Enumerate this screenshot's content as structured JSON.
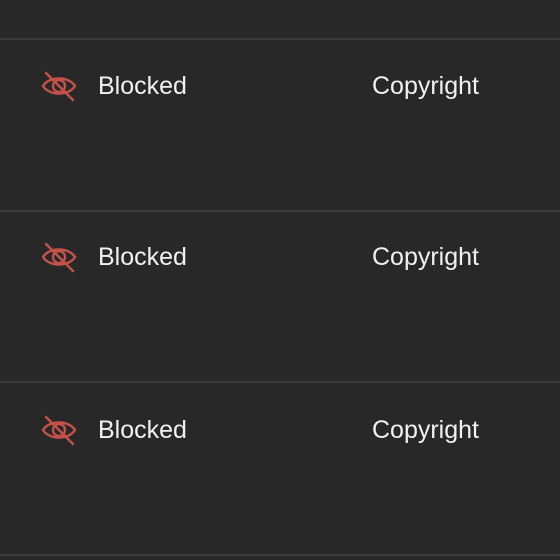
{
  "colors": {
    "background": "#282828",
    "divider": "#3a3a3a",
    "text": "#f1f1f1",
    "blocked_icon": "#c4524a"
  },
  "rows": [
    {
      "visibility": "Blocked",
      "visibility_icon": "eye-off-icon",
      "restriction": "Copyright"
    },
    {
      "visibility": "Blocked",
      "visibility_icon": "eye-off-icon",
      "restriction": "Copyright"
    },
    {
      "visibility": "Blocked",
      "visibility_icon": "eye-off-icon",
      "restriction": "Copyright"
    }
  ]
}
